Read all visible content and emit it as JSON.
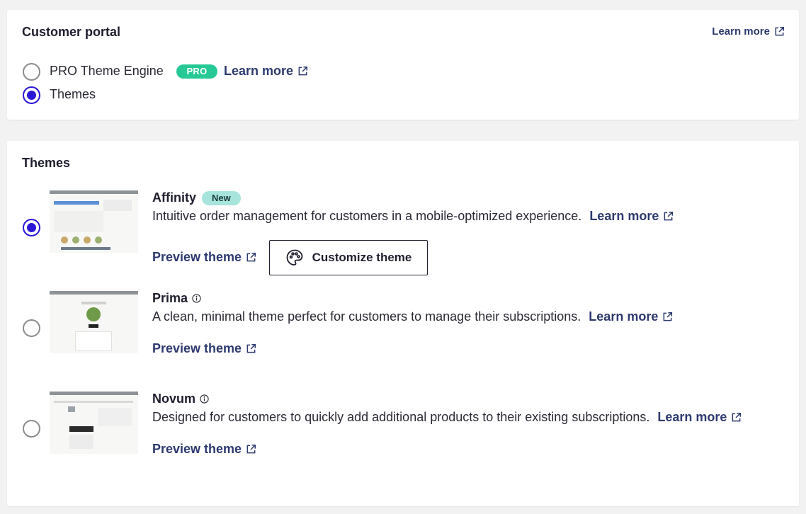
{
  "portal": {
    "title": "Customer portal",
    "learn_more": "Learn more",
    "options": [
      {
        "label": "PRO Theme Engine",
        "badge": "PRO",
        "link": "Learn more",
        "selected": false
      },
      {
        "label": "Themes",
        "selected": true
      }
    ]
  },
  "themes": {
    "title": "Themes",
    "items": [
      {
        "name": "Affinity",
        "badge": "New",
        "description": "Intuitive order management for customers in a mobile-optimized experience.",
        "learn_more": "Learn more",
        "preview": "Preview theme",
        "customize": "Customize theme",
        "selected": true
      },
      {
        "name": "Prima",
        "description": "A clean, minimal theme perfect for customers to manage their subscriptions.",
        "learn_more": "Learn more",
        "preview": "Preview theme",
        "selected": false
      },
      {
        "name": "Novum",
        "description": "Designed for customers to quickly add additional products to their existing subscriptions.",
        "learn_more": "Learn more",
        "preview": "Preview theme",
        "selected": false
      }
    ]
  },
  "colors": {
    "accent": "#2b17d6",
    "link": "#2d3a6e",
    "pro_badge": "#26c996",
    "new_badge": "#a7e4dc"
  },
  "icons": {
    "external": "external-link-icon",
    "info": "info-icon",
    "palette": "palette-icon"
  }
}
